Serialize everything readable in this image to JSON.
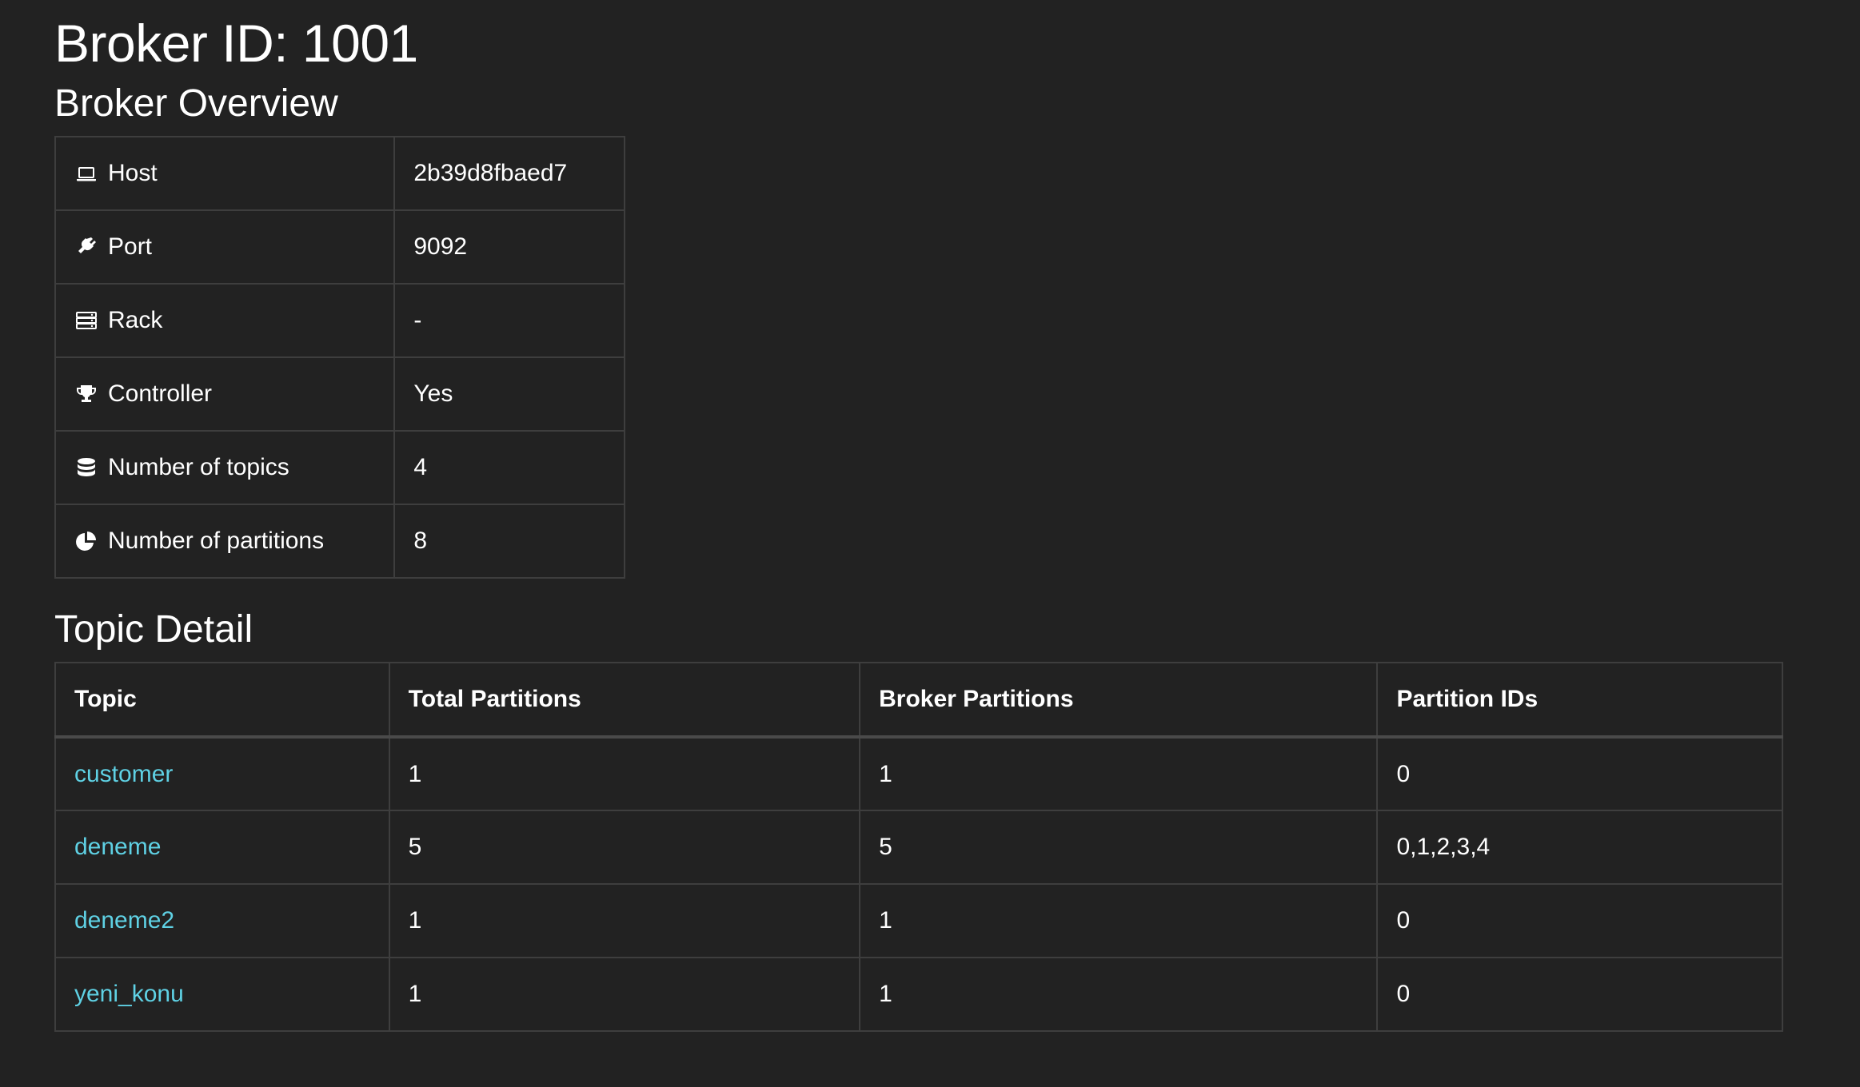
{
  "page": {
    "title": "Broker ID: 1001"
  },
  "overview": {
    "heading": "Broker Overview",
    "rows": [
      {
        "icon": "laptop-icon",
        "label": "Host",
        "value": "2b39d8fbaed7"
      },
      {
        "icon": "plug-icon",
        "label": "Port",
        "value": "9092"
      },
      {
        "icon": "server-icon",
        "label": "Rack",
        "value": "-"
      },
      {
        "icon": "trophy-icon",
        "label": "Controller",
        "value": "Yes"
      },
      {
        "icon": "database-icon",
        "label": "Number of topics",
        "value": "4"
      },
      {
        "icon": "pie-chart-icon",
        "label": "Number of partitions",
        "value": "8"
      }
    ]
  },
  "topics": {
    "heading": "Topic Detail",
    "columns": [
      "Topic",
      "Total Partitions",
      "Broker Partitions",
      "Partition IDs"
    ],
    "rows": [
      {
        "topic": "customer",
        "total": "1",
        "broker": "1",
        "ids": "0"
      },
      {
        "topic": "deneme",
        "total": "5",
        "broker": "5",
        "ids": "0,1,2,3,4"
      },
      {
        "topic": "deneme2",
        "total": "1",
        "broker": "1",
        "ids": "0"
      },
      {
        "topic": "yeni_konu",
        "total": "1",
        "broker": "1",
        "ids": "0"
      }
    ]
  },
  "colors": {
    "background": "#222222",
    "text": "#ffffff",
    "link": "#5fd1e4",
    "border": "#3e3e3e"
  }
}
